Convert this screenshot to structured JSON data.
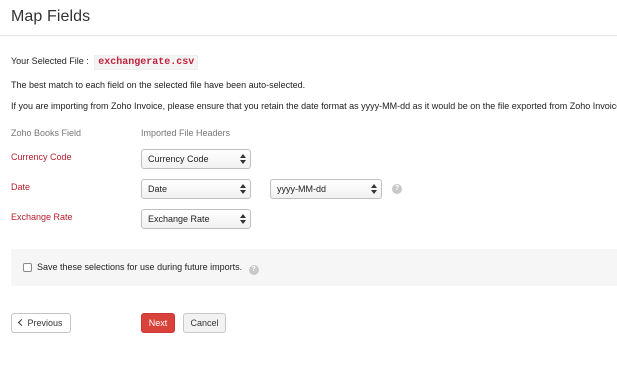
{
  "header": {
    "title": "Map Fields"
  },
  "file": {
    "label": "Your Selected File :",
    "name": "exchangerate.csv"
  },
  "info": {
    "auto_selected": "The best match to each field on the selected file have been auto-selected.",
    "zoho_invoice_note": "If you are importing from Zoho Invoice, please ensure that you retain the date format as yyyy-MM-dd as it would be on the file exported from Zoho Invoice."
  },
  "columns": {
    "books_field": "Zoho Books Field",
    "imported_headers": "Imported File Headers"
  },
  "fields": [
    {
      "label": "Currency Code",
      "selected": "Currency Code"
    },
    {
      "label": "Date",
      "selected": "Date",
      "format": "yyyy-MM-dd"
    },
    {
      "label": "Exchange Rate",
      "selected": "Exchange Rate"
    }
  ],
  "save_selection": {
    "label": "Save these selections for use during future imports.",
    "checked": false
  },
  "buttons": {
    "previous": "Previous",
    "next": "Next",
    "cancel": "Cancel"
  },
  "colors": {
    "field_label": "#b4212e",
    "primary_button": "#d9413b",
    "filename": "#c0223e"
  },
  "icons": {
    "help": "question-circle-icon",
    "previous": "chevron-left-icon",
    "select": "select-arrows-icon"
  }
}
